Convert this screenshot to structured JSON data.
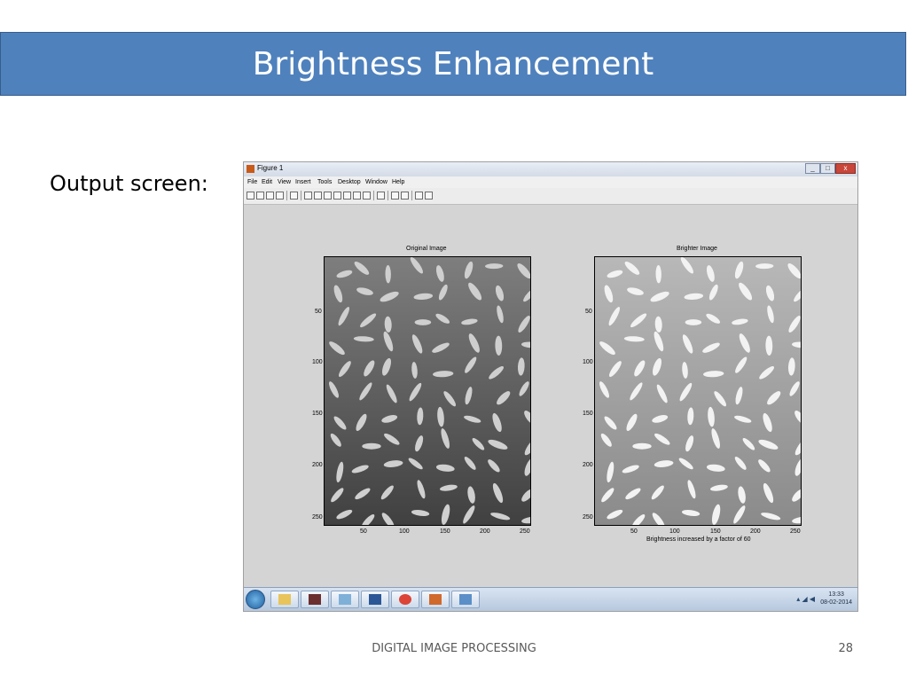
{
  "slide": {
    "title": "Brightness Enhancement",
    "output_label": "Output screen:",
    "footer": "DIGITAL IMAGE PROCESSING",
    "page_number": "28"
  },
  "window": {
    "title": "Figure 1",
    "controls": {
      "minimize": "_",
      "maximize": "□",
      "close": "x"
    },
    "menu": [
      "File",
      "Edit",
      "View",
      "Insert",
      "Tools",
      "Desktop",
      "Window",
      "Help"
    ],
    "toolbar_icons": [
      "new-icon",
      "open-icon",
      "save-icon",
      "print-icon",
      "pointer-icon",
      "zoom-in-icon",
      "zoom-out-icon",
      "pan-icon",
      "rotate-icon",
      "datacursor-icon",
      "brush-icon",
      "link-icon",
      "colorbar-icon",
      "legend-icon",
      "hide-icon",
      "show-icon"
    ]
  },
  "plots": {
    "left": {
      "title": "Original Image",
      "xticks": [
        "50",
        "100",
        "150",
        "200",
        "250"
      ],
      "yticks": [
        "50",
        "100",
        "150",
        "200",
        "250"
      ]
    },
    "right": {
      "title": "Brighter Image",
      "xticks": [
        "50",
        "100",
        "150",
        "200",
        "250"
      ],
      "yticks": [
        "50",
        "100",
        "150",
        "200",
        "250"
      ],
      "xlabel": "Brightness increased by a factor of 60"
    }
  },
  "taskbar": {
    "apps": [
      "windows-start-icon",
      "file-explorer-icon",
      "media-player-icon",
      "notepad-icon",
      "word-icon",
      "chrome-icon",
      "matlab-icon",
      "remote-desktop-icon"
    ],
    "time": "13:33",
    "date": "08-02-2014"
  },
  "colors": {
    "title_bar": "#4f81bd",
    "figure_bg": "#d4d4d4"
  }
}
